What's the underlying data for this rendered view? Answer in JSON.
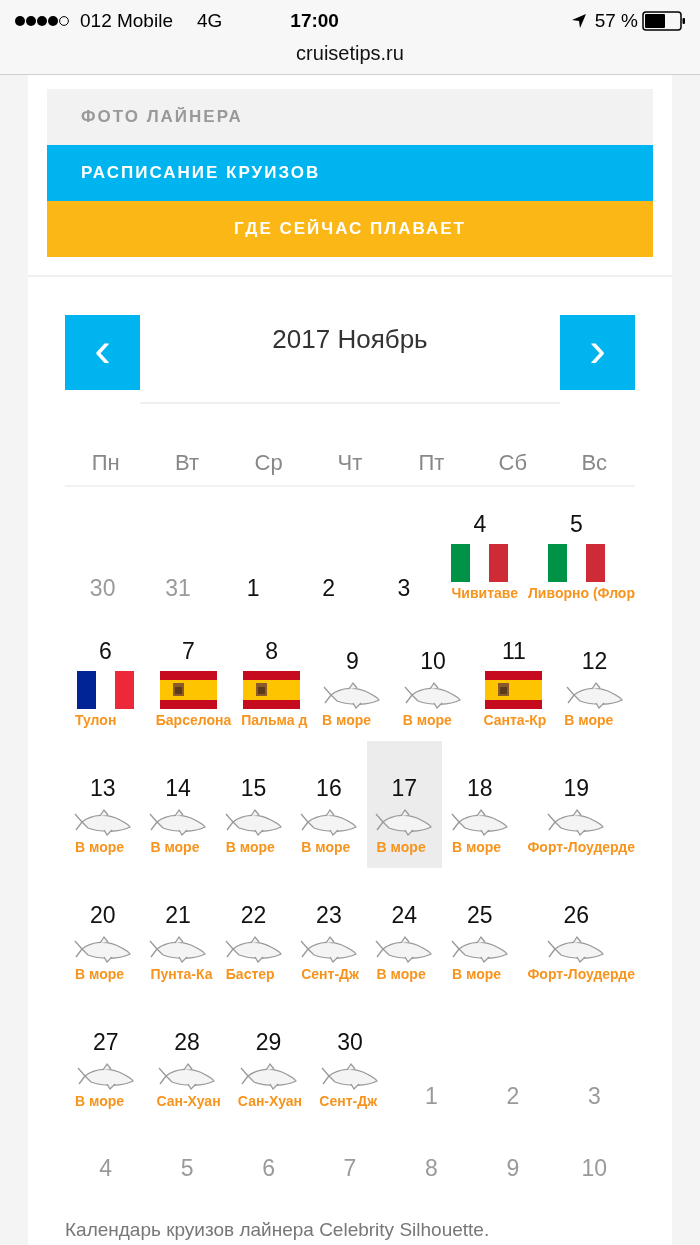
{
  "status_bar": {
    "carrier": "012 Mobile",
    "network": "4G",
    "time": "17:00",
    "battery": "57 %"
  },
  "address_bar": {
    "url": "cruisetips.ru"
  },
  "menu": [
    {
      "label": "ФОТО ЛАЙНЕРА",
      "kind": "plain"
    },
    {
      "label": "РАСПИСАНИЕ КРУИЗОВ",
      "kind": "blue"
    },
    {
      "label": "ГДЕ СЕЙЧАС ПЛАВАЕТ",
      "kind": "yellow"
    }
  ],
  "calendar": {
    "title": "2017 Ноябрь",
    "prev": "‹",
    "next": "›",
    "weekdays": [
      "Пн",
      "Вт",
      "Ср",
      "Чт",
      "Пт",
      "Сб",
      "Вс"
    ],
    "weeks": [
      [
        {
          "day": "30",
          "muted": true,
          "selected": false
        },
        {
          "day": "31",
          "muted": true,
          "selected": false
        },
        {
          "day": "1",
          "muted": false,
          "selected": false
        },
        {
          "day": "2",
          "muted": false,
          "selected": false
        },
        {
          "day": "3",
          "muted": false,
          "selected": false
        },
        {
          "day": "4",
          "muted": false,
          "selected": false,
          "kind": "italy",
          "label": "Чивитаве"
        },
        {
          "day": "5",
          "muted": false,
          "selected": false,
          "kind": "italy",
          "label": "Ливорно (Флор"
        }
      ],
      [
        {
          "day": "6",
          "muted": false,
          "selected": false,
          "kind": "france",
          "label": "Тулон"
        },
        {
          "day": "7",
          "muted": false,
          "selected": false,
          "kind": "spain",
          "label": "Барселона"
        },
        {
          "day": "8",
          "muted": false,
          "selected": false,
          "kind": "spain",
          "label": "Пальма д"
        },
        {
          "day": "9",
          "muted": false,
          "selected": false,
          "kind": "sea",
          "label": "В море"
        },
        {
          "day": "10",
          "muted": false,
          "selected": false,
          "kind": "sea",
          "label": "В море"
        },
        {
          "day": "11",
          "muted": false,
          "selected": false,
          "kind": "spain",
          "label": "Санта-Кр"
        },
        {
          "day": "12",
          "muted": false,
          "selected": false,
          "kind": "sea",
          "label": "В море"
        }
      ],
      [
        {
          "day": "13",
          "muted": false,
          "selected": false,
          "kind": "sea",
          "label": "В море"
        },
        {
          "day": "14",
          "muted": false,
          "selected": false,
          "kind": "sea",
          "label": "В море"
        },
        {
          "day": "15",
          "muted": false,
          "selected": false,
          "kind": "sea",
          "label": "В море"
        },
        {
          "day": "16",
          "muted": false,
          "selected": false,
          "kind": "sea",
          "label": "В море"
        },
        {
          "day": "17",
          "muted": false,
          "selected": true,
          "kind": "sea",
          "label": "В море"
        },
        {
          "day": "18",
          "muted": false,
          "selected": false,
          "kind": "sea",
          "label": "В море"
        },
        {
          "day": "19",
          "muted": false,
          "selected": false,
          "kind": "sea",
          "label": "Форт-Лоудерде"
        }
      ],
      [
        {
          "day": "20",
          "muted": false,
          "selected": false,
          "kind": "sea",
          "label": "В море"
        },
        {
          "day": "21",
          "muted": false,
          "selected": false,
          "kind": "sea",
          "label": "Пунта-Ка"
        },
        {
          "day": "22",
          "muted": false,
          "selected": false,
          "kind": "sea",
          "label": "Бастер"
        },
        {
          "day": "23",
          "muted": false,
          "selected": false,
          "kind": "sea",
          "label": "Сент-Дж"
        },
        {
          "day": "24",
          "muted": false,
          "selected": false,
          "kind": "sea",
          "label": "В море"
        },
        {
          "day": "25",
          "muted": false,
          "selected": false,
          "kind": "sea",
          "label": "В море"
        },
        {
          "day": "26",
          "muted": false,
          "selected": false,
          "kind": "sea",
          "label": "Форт-Лоудерде"
        }
      ],
      [
        {
          "day": "27",
          "muted": false,
          "selected": false,
          "kind": "sea",
          "label": "В море"
        },
        {
          "day": "28",
          "muted": false,
          "selected": false,
          "kind": "sea",
          "label": "Сан-Хуан"
        },
        {
          "day": "29",
          "muted": false,
          "selected": false,
          "kind": "sea",
          "label": "Сан-Хуан"
        },
        {
          "day": "30",
          "muted": false,
          "selected": false,
          "kind": "sea",
          "label": "Сент-Дж"
        },
        {
          "day": "1",
          "muted": true,
          "selected": false
        },
        {
          "day": "2",
          "muted": true,
          "selected": false
        },
        {
          "day": "3",
          "muted": true,
          "selected": false
        }
      ],
      [
        {
          "day": "4",
          "muted": true,
          "selected": false
        },
        {
          "day": "5",
          "muted": true,
          "selected": false
        },
        {
          "day": "6",
          "muted": true,
          "selected": false
        },
        {
          "day": "7",
          "muted": true,
          "selected": false
        },
        {
          "day": "8",
          "muted": true,
          "selected": false
        },
        {
          "day": "9",
          "muted": true,
          "selected": false
        },
        {
          "day": "10",
          "muted": true,
          "selected": false
        }
      ]
    ],
    "caption": "Календарь круизов лайнера Celebrity Silhouette."
  }
}
